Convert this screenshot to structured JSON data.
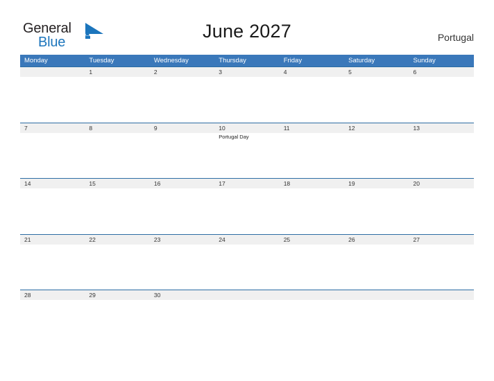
{
  "brand": {
    "name_part1": "General",
    "name_part2": "Blue",
    "mark": "blue-triangle-flag-icon",
    "colors": {
      "general_text": "#231f20",
      "blue_text": "#1c75bc",
      "mark": "#1c75bc"
    }
  },
  "header": {
    "title": "June 2027",
    "country": "Portugal"
  },
  "calendar": {
    "theme": {
      "header_bg": "#3a78ba",
      "header_text": "#ffffff",
      "date_band_bg": "#f0f0f0",
      "rule_color": "#2b6ca3",
      "date_text": "#333333"
    },
    "weekdays": [
      "Monday",
      "Tuesday",
      "Wednesday",
      "Thursday",
      "Friday",
      "Saturday",
      "Sunday"
    ],
    "weeks": [
      {
        "days": [
          {
            "date": "",
            "event": ""
          },
          {
            "date": "1",
            "event": ""
          },
          {
            "date": "2",
            "event": ""
          },
          {
            "date": "3",
            "event": ""
          },
          {
            "date": "4",
            "event": ""
          },
          {
            "date": "5",
            "event": ""
          },
          {
            "date": "6",
            "event": ""
          }
        ]
      },
      {
        "days": [
          {
            "date": "7",
            "event": ""
          },
          {
            "date": "8",
            "event": ""
          },
          {
            "date": "9",
            "event": ""
          },
          {
            "date": "10",
            "event": "Portugal Day"
          },
          {
            "date": "11",
            "event": ""
          },
          {
            "date": "12",
            "event": ""
          },
          {
            "date": "13",
            "event": ""
          }
        ]
      },
      {
        "days": [
          {
            "date": "14",
            "event": ""
          },
          {
            "date": "15",
            "event": ""
          },
          {
            "date": "16",
            "event": ""
          },
          {
            "date": "17",
            "event": ""
          },
          {
            "date": "18",
            "event": ""
          },
          {
            "date": "19",
            "event": ""
          },
          {
            "date": "20",
            "event": ""
          }
        ]
      },
      {
        "days": [
          {
            "date": "21",
            "event": ""
          },
          {
            "date": "22",
            "event": ""
          },
          {
            "date": "23",
            "event": ""
          },
          {
            "date": "24",
            "event": ""
          },
          {
            "date": "25",
            "event": ""
          },
          {
            "date": "26",
            "event": ""
          },
          {
            "date": "27",
            "event": ""
          }
        ]
      },
      {
        "days": [
          {
            "date": "28",
            "event": ""
          },
          {
            "date": "29",
            "event": ""
          },
          {
            "date": "30",
            "event": ""
          },
          {
            "date": "",
            "event": ""
          },
          {
            "date": "",
            "event": ""
          },
          {
            "date": "",
            "event": ""
          },
          {
            "date": "",
            "event": ""
          }
        ]
      }
    ]
  }
}
